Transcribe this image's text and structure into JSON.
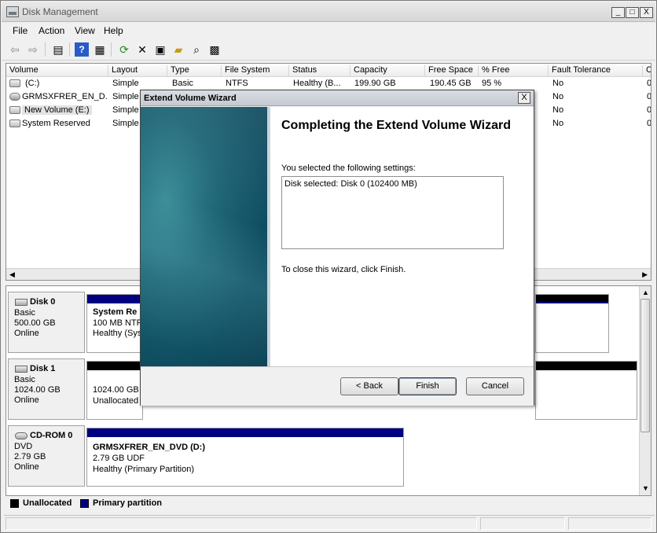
{
  "window": {
    "title": "Disk Management",
    "minimize": "_",
    "maximize": "□",
    "close": "X"
  },
  "menu": [
    "File",
    "Action",
    "View",
    "Help"
  ],
  "toolbar_icons": [
    "back-arrow-icon",
    "forward-arrow-icon",
    "console-tree-icon",
    "help-icon",
    "properties-icon",
    "refresh-icon",
    "delete-icon",
    "properties-page-icon",
    "open-folder-icon",
    "search-icon",
    "rescan-icon"
  ],
  "volume_list": {
    "columns": [
      "Volume",
      "Layout",
      "Type",
      "File System",
      "Status",
      "Capacity",
      "Free Space",
      "% Free",
      "Fault Tolerance",
      "C"
    ],
    "rows": [
      {
        "volume": "(C:)",
        "layout": "Simple",
        "type": "Basic",
        "fs": "NTFS",
        "status": "Healthy (B...",
        "capacity": "199.90 GB",
        "free": "190.45 GB",
        "pct": "95 %",
        "fault": "No",
        "c": "0"
      },
      {
        "volume": "GRMSXFRER_EN_D...",
        "layout": "Simple",
        "type": "",
        "fs": "",
        "status": "",
        "capacity": "",
        "free": "",
        "pct": "",
        "fault": "No",
        "c": "0"
      },
      {
        "volume": "New Volume (E:)",
        "layout": "Simple",
        "type": "",
        "fs": "",
        "status": "",
        "capacity": "",
        "free": "",
        "pct": "",
        "fault": "No",
        "c": "0"
      },
      {
        "volume": "System Reserved",
        "layout": "Simple",
        "type": "",
        "fs": "",
        "status": "",
        "capacity": "",
        "free": "",
        "pct": "",
        "fault": "No",
        "c": "0"
      }
    ]
  },
  "disks": [
    {
      "name": "Disk 0",
      "type": "Basic",
      "size": "500.00 GB",
      "state": "Online",
      "part1": {
        "name": "System Re",
        "line2": "100 MB NTFS",
        "line3": "Healthy (Sys"
      }
    },
    {
      "name": "Disk 1",
      "type": "Basic",
      "size": "1024.00 GB",
      "state": "Online",
      "part1": {
        "line1": "1024.00 GB",
        "line2": "Unallocated"
      }
    },
    {
      "name": "CD-ROM 0",
      "type": "DVD",
      "size": "2.79 GB",
      "state": "Online",
      "part1": {
        "name": "GRMSXFRER_EN_DVD  (D:)",
        "line2": "2.79 GB UDF",
        "line3": "Healthy (Primary Partition)"
      }
    }
  ],
  "legend": {
    "unallocated": "Unallocated",
    "primary": "Primary partition",
    "unallocated_color": "#000000",
    "primary_color": "#000080"
  },
  "wizard": {
    "title": "Extend Volume Wizard",
    "close": "X",
    "heading": "Completing the Extend Volume Wizard",
    "settings_label": "You selected the following settings:",
    "settings_value": "Disk selected: Disk 0 (102400 MB)",
    "close_hint": "To close this wizard, click Finish.",
    "back_label": "< Back",
    "finish_label": "Finish",
    "cancel_label": "Cancel"
  }
}
